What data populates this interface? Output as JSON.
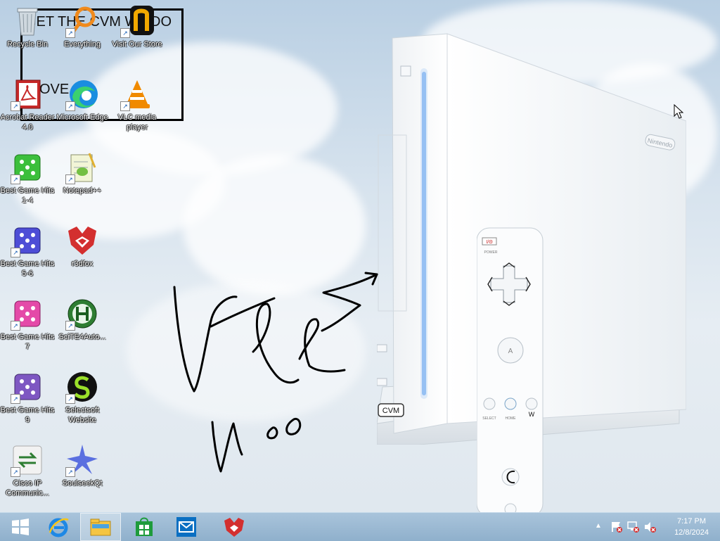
{
  "desktop": {
    "icons": [
      {
        "label": "Recycle Bin",
        "icon": "recycle-bin-icon"
      },
      {
        "label": "Everything",
        "icon": "everything-search-icon"
      },
      {
        "label": "Visit Our Store",
        "icon": "store-icon"
      },
      {
        "label": "Acrobat Reader 4.0",
        "icon": "acrobat-reader-icon"
      },
      {
        "label": "Microsoft Edge",
        "icon": "edge-icon"
      },
      {
        "label": "VLC media player",
        "icon": "vlc-icon"
      },
      {
        "label": "Best Game Hits 1-4",
        "icon": "dice-icon"
      },
      {
        "label": "Notepad++",
        "icon": "notepad-plus-icon"
      },
      {
        "label": "Best Game Hits 5-6",
        "icon": "dice-icon"
      },
      {
        "label": "r3dfox",
        "icon": "r3dfox-icon"
      },
      {
        "label": "Best Game Hits 7",
        "icon": "dice-icon"
      },
      {
        "label": "SciTE4Auto...",
        "icon": "scite-icon"
      },
      {
        "label": "Best Game Hits 9",
        "icon": "dice-icon"
      },
      {
        "label": "Selectsoft Website",
        "icon": "selectsoft-icon"
      },
      {
        "label": "Cisco IP Communic...",
        "icon": "cisco-icon"
      },
      {
        "label": "SoulseekQt",
        "icon": "soulseek-icon"
      }
    ]
  },
  "overlay": {
    "line1": "GET THE CVM W",
    "line1b": "DO",
    "line2": "OVE"
  },
  "wallpaper": {
    "brand": "Nintendo",
    "console_label": "CVM",
    "remote_power": "I/Θ",
    "remote_power_caption": "POWER",
    "remote_a": "A",
    "remote_select": "SELECT",
    "remote_home": "HOME",
    "remote_w": "W",
    "scribble_top": "Wee",
    "scribble_bottom": "woo"
  },
  "taskbar": {
    "items": [
      {
        "name": "start",
        "icon": "windows-start-icon"
      },
      {
        "name": "internet-explorer",
        "icon": "ie-icon"
      },
      {
        "name": "file-explorer",
        "icon": "folder-icon",
        "active": true
      },
      {
        "name": "store",
        "icon": "store-bag-icon"
      },
      {
        "name": "mail",
        "icon": "mail-icon"
      },
      {
        "name": "r3dfox",
        "icon": "r3dfox-icon"
      }
    ],
    "time": "7:17 PM",
    "date": "12/8/2024"
  }
}
